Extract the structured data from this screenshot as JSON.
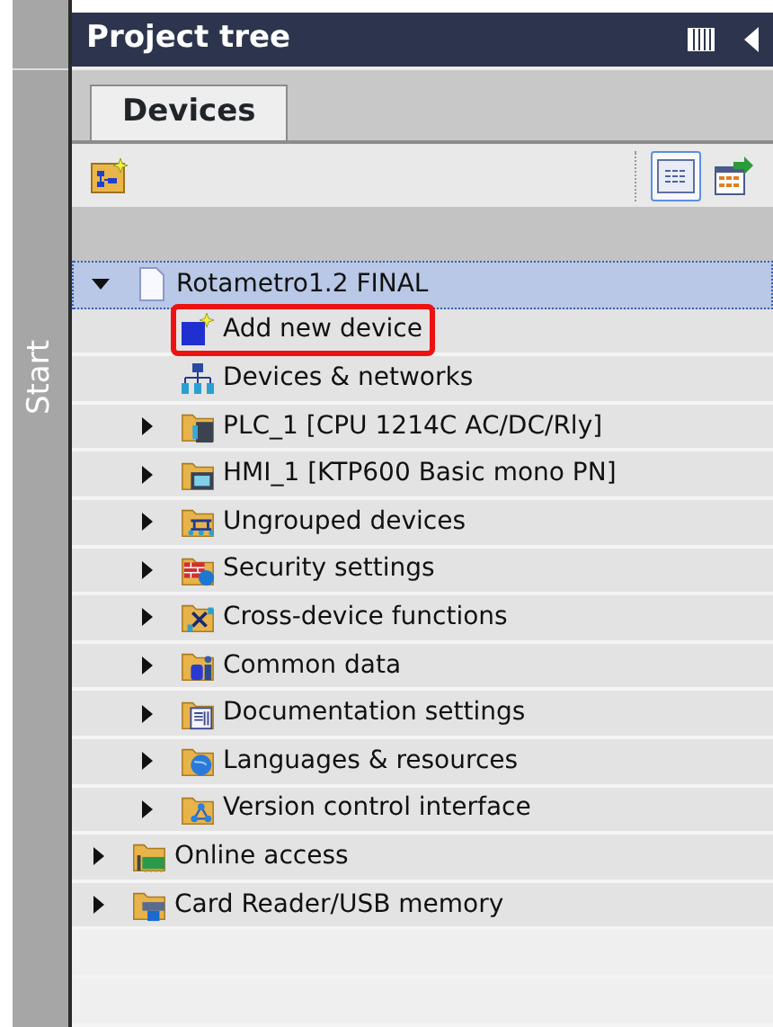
{
  "side_tab": {
    "label": "Start"
  },
  "panel": {
    "title": "Project tree"
  },
  "tabs": [
    {
      "label": "Devices",
      "selected": true
    }
  ],
  "toolbar": {
    "view_toggle_on": true
  },
  "tree": [
    {
      "label": "Rotametro1.2 FINAL",
      "kind": "project",
      "expanded": true,
      "selected": true,
      "highlighted": false,
      "children": [
        {
          "label": "Add new device",
          "kind": "add-device",
          "selected": false,
          "highlighted": true
        },
        {
          "label": "Devices & networks",
          "kind": "network",
          "selected": false,
          "highlighted": false
        },
        {
          "label": "PLC_1 [CPU 1214C AC/DC/Rly]",
          "kind": "plc-folder",
          "expanded": false,
          "selected": false,
          "highlighted": false
        },
        {
          "label": "HMI_1 [KTP600 Basic mono PN]",
          "kind": "hmi-folder",
          "expanded": false,
          "selected": false,
          "highlighted": false
        },
        {
          "label": "Ungrouped devices",
          "kind": "group-folder",
          "expanded": false,
          "selected": false,
          "highlighted": false
        },
        {
          "label": "Security settings",
          "kind": "security-folder",
          "expanded": false,
          "selected": false,
          "highlighted": false
        },
        {
          "label": "Cross-device functions",
          "kind": "cross-folder",
          "expanded": false,
          "selected": false,
          "highlighted": false
        },
        {
          "label": "Common data",
          "kind": "common-folder",
          "expanded": false,
          "selected": false,
          "highlighted": false
        },
        {
          "label": "Documentation settings",
          "kind": "docs-folder",
          "expanded": false,
          "selected": false,
          "highlighted": false
        },
        {
          "label": "Languages & resources",
          "kind": "globe-folder",
          "expanded": false,
          "selected": false,
          "highlighted": false
        },
        {
          "label": "Version control interface",
          "kind": "version-folder",
          "expanded": false,
          "selected": false,
          "highlighted": false
        }
      ]
    },
    {
      "label": "Online access",
      "kind": "online-folder",
      "expanded": false,
      "selected": false,
      "highlighted": false
    },
    {
      "label": "Card Reader/USB memory",
      "kind": "card-folder",
      "expanded": false,
      "selected": false,
      "highlighted": false
    }
  ]
}
